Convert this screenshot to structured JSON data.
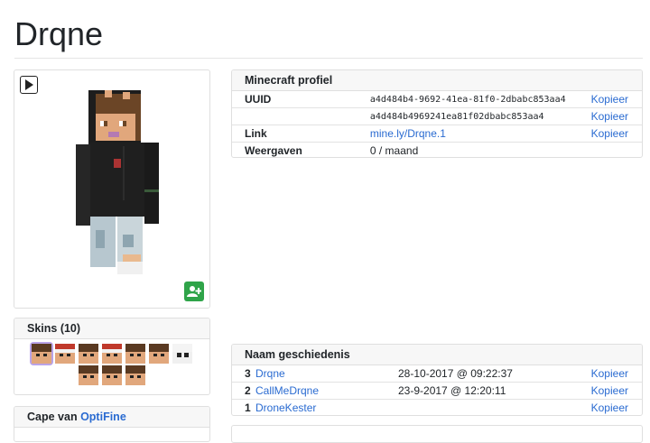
{
  "page_title": "Drqne",
  "skin_viewer": {
    "play_icon": "play-icon",
    "add_icon": "add-friend-icon",
    "accent": "#2fa449"
  },
  "skins": {
    "header": "Skins (10)",
    "count": 10
  },
  "cape": {
    "header_prefix": "Cape van",
    "header_link": "OptiFine"
  },
  "profile": {
    "header": "Minecraft profiel",
    "rows": [
      {
        "label": "UUID",
        "value": "a4d484b4-9692-41ea-81f0-2dbabc853aa4",
        "action": "Kopieer"
      },
      {
        "label": "",
        "value": "a4d484b4969241ea81f02dbabc853aa4",
        "action": "Kopieer"
      },
      {
        "label": "Link",
        "value": "mine.ly/Drqne.1",
        "action": "Kopieer"
      },
      {
        "label": "Weergaven",
        "value": "0 / maand",
        "action": ""
      }
    ]
  },
  "history": {
    "header": "Naam geschiedenis",
    "rows": [
      {
        "num": "3",
        "name": "Drqne",
        "date": "28-10-2017 @ 09:22:37",
        "action": "Kopieer"
      },
      {
        "num": "2",
        "name": "CallMeDrqne",
        "date": "23-9-2017 @ 12:20:11",
        "action": "Kopieer"
      },
      {
        "num": "1",
        "name": "DroneKester",
        "date": "",
        "action": "Kopieer"
      }
    ]
  },
  "colors": {
    "link": "#2a6bd1",
    "card_header_bg": "#f7f7f7",
    "selected_outline": "#b9a3e8"
  }
}
